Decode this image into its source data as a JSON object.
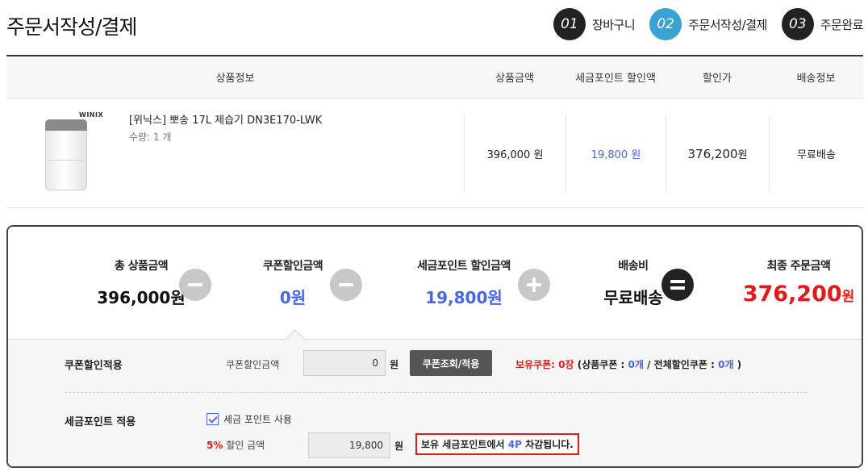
{
  "page": {
    "title": "주문서작성/결제"
  },
  "steps": [
    {
      "num": "01",
      "label": "장바구니",
      "active": false
    },
    {
      "num": "02",
      "label": "주문서작성/결제",
      "active": true
    },
    {
      "num": "03",
      "label": "주문완료",
      "active": false
    }
  ],
  "table": {
    "headers": [
      "상품정보",
      "상품금액",
      "세금포인트 할인액",
      "할인가",
      "배송정보"
    ],
    "row": {
      "brand": "WINIX",
      "name": "[위닉스] 뽀송 17L 제습기 DN3E170-LWK",
      "qty_label": "수량: 1 개",
      "price": "396,000 원",
      "point_discount": "19,800 원",
      "discounted_price": "376,200",
      "discounted_unit": "원",
      "shipping": "무료배송"
    }
  },
  "summary": {
    "total_label": "총 상품금액",
    "total_value": "396,000원",
    "coupon_label": "쿠폰할인금액",
    "coupon_value": "0원",
    "point_label": "세금포인트 할인금액",
    "point_value": "19,800원",
    "shipping_label": "배송비",
    "shipping_value": "무료배송",
    "final_label": "최종 주문금액",
    "final_value": "376,200",
    "final_unit": "원"
  },
  "coupon": {
    "row_label": "쿠폰할인적용",
    "field_label": "쿠폰할인금액",
    "field_value": "0",
    "unit": "원",
    "button_label": "쿠폰조회/적용",
    "held_label": "보유쿠폰:",
    "held_count": "0장",
    "product_coupon_prefix": "(상품쿠폰 :",
    "product_coupon_count": "0개",
    "total_coupon_prefix": "/ 전체할인쿠폰 :",
    "total_coupon_count": "0개",
    "close_paren": ")"
  },
  "point": {
    "row_label": "세금포인트 적용",
    "checkbox_label": "세금 포인트 사용",
    "rate": "5%",
    "rate_suffix": "할인 금액",
    "field_value": "19,800",
    "unit": "원",
    "notice_prefix": "보유 세금포인트에서",
    "notice_points": "4P",
    "notice_suffix": "차감됩니다."
  },
  "colors": {
    "accent_blue": "#4a66e8",
    "alert_red": "#e41a1a",
    "step_active": "#3aa3d3"
  },
  "icons": [
    "minus-icon",
    "minus-icon",
    "plus-icon",
    "equals-icon",
    "check-icon"
  ]
}
